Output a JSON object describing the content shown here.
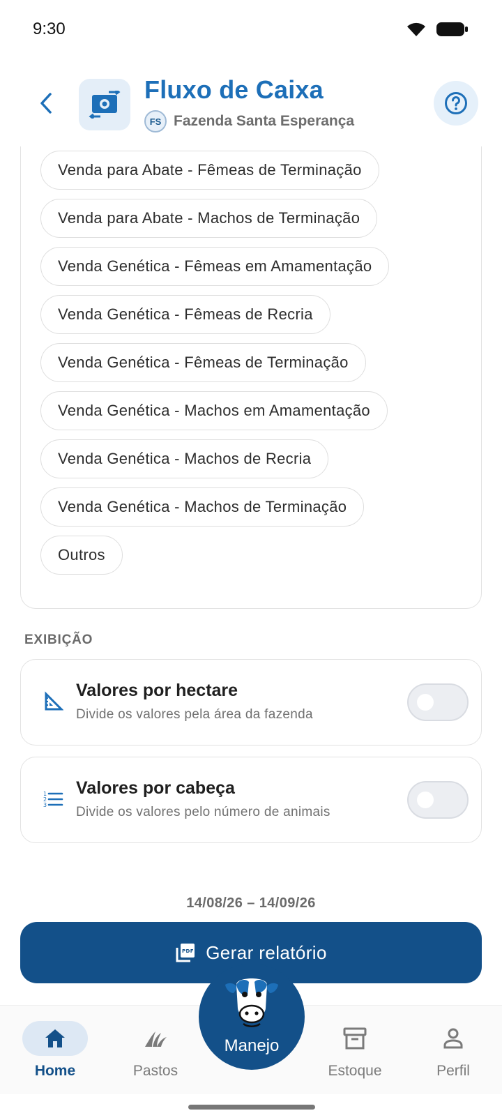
{
  "status_bar": {
    "time": "9:30"
  },
  "header": {
    "title": "Fluxo de Caixa",
    "farm_initials": "FS",
    "farm_name": "Fazenda Santa Esperança"
  },
  "categories": [
    "Venda para Abate - Fêmeas de Terminação",
    "Venda para Abate - Machos de Terminação",
    "Venda Genética - Fêmeas em Amamentação",
    "Venda Genética - Fêmeas de Recria",
    "Venda Genética - Fêmeas de Terminação",
    "Venda Genética - Machos em Amamentação",
    "Venda Genética - Machos de Recria",
    "Venda Genética - Machos de Terminação",
    "Outros"
  ],
  "display_section": {
    "label": "EXIBIÇÃO",
    "toggles": [
      {
        "title": "Valores por hectare",
        "description": "Divide os valores pela área da fazenda",
        "enabled": false
      },
      {
        "title": "Valores por cabeça",
        "description": "Divide os valores pelo número de animais",
        "enabled": false
      }
    ]
  },
  "date_range": "14/08/26 – 14/09/26",
  "generate_button": {
    "label": "Gerar relatório"
  },
  "bottom_nav": {
    "items": [
      {
        "label": "Home",
        "icon": "home-icon",
        "active": true
      },
      {
        "label": "Pastos",
        "icon": "grass-icon",
        "active": false
      },
      {
        "label": "Estoque",
        "icon": "archive-icon",
        "active": false
      },
      {
        "label": "Perfil",
        "icon": "person-icon",
        "active": false
      }
    ],
    "center": {
      "label": "Manejo",
      "icon": "cow-icon"
    }
  },
  "colors": {
    "primary": "#135089",
    "accent": "#1d6fb8",
    "icon_bg": "#e4eef8"
  }
}
